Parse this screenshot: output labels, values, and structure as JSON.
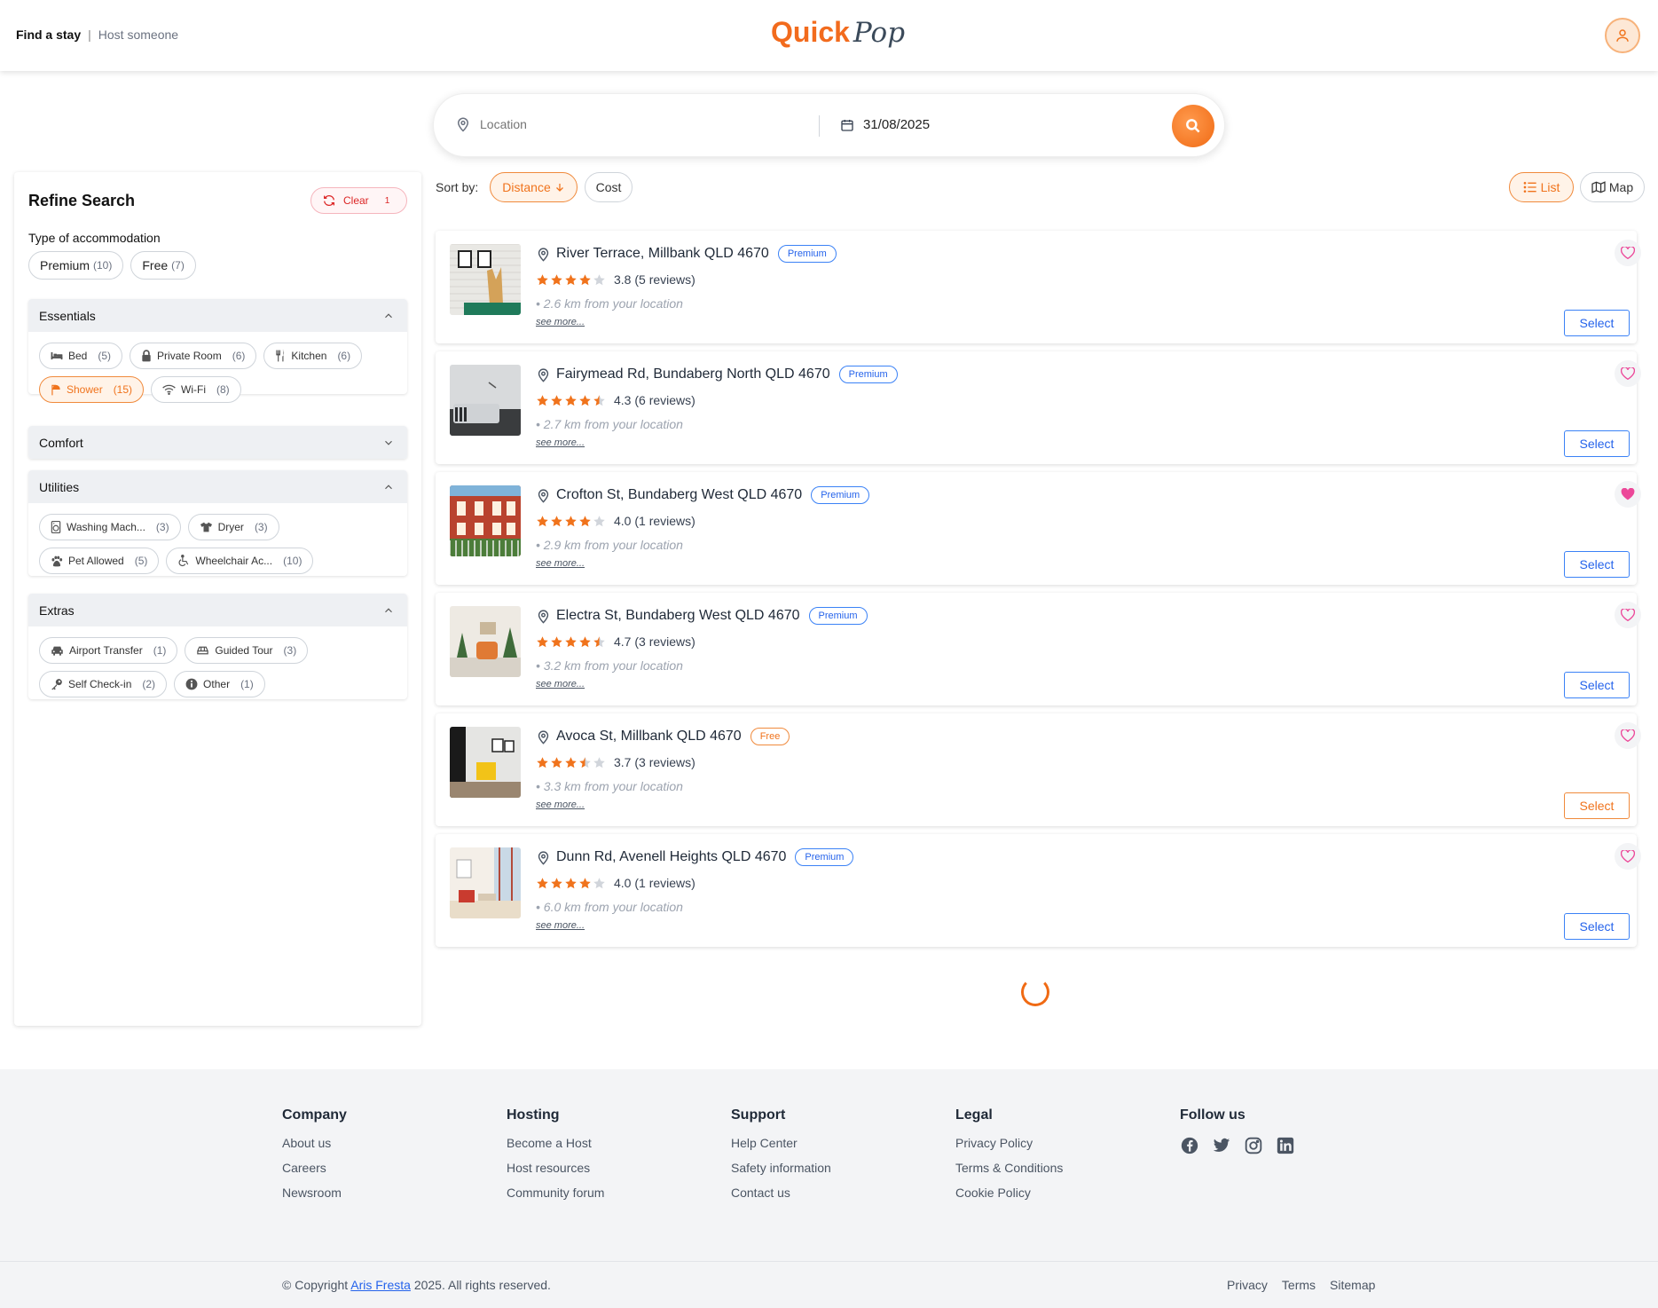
{
  "header": {
    "nav_active": "Find a stay",
    "nav_separator": "|",
    "nav_inactive": "Host someone",
    "logo_quick": "Quick",
    "logo_pop": "Pop"
  },
  "search": {
    "location_placeholder": "Location",
    "date_value": "31/08/2025"
  },
  "sidebar": {
    "title": "Refine Search",
    "clear_label": "Clear",
    "clear_count": "1",
    "type_label": "Type of accommodation",
    "type_chips": [
      {
        "label": "Premium",
        "count": "(10)"
      },
      {
        "label": "Free",
        "count": "(7)"
      }
    ],
    "sections": {
      "essentials": {
        "title": "Essentials",
        "chips": [
          {
            "icon": "bed-icon",
            "label": "Bed",
            "count": "(5)"
          },
          {
            "icon": "lock-icon",
            "label": "Private Room",
            "count": "(6)"
          },
          {
            "icon": "utensils-icon",
            "label": "Kitchen",
            "count": "(6)"
          },
          {
            "icon": "shower-icon",
            "label": "Shower",
            "count": "(15)",
            "selected": true
          },
          {
            "icon": "wifi-icon",
            "label": "Wi-Fi",
            "count": "(8)"
          }
        ]
      },
      "comfort": {
        "title": "Comfort"
      },
      "utilities": {
        "title": "Utilities",
        "chips": [
          {
            "icon": "washing-machine-icon",
            "label": "Washing Mach...",
            "count": "(3)"
          },
          {
            "icon": "shirt-icon",
            "label": "Dryer",
            "count": "(3)"
          },
          {
            "icon": "paw-icon",
            "label": "Pet Allowed",
            "count": "(5)"
          },
          {
            "icon": "wheelchair-icon",
            "label": "Wheelchair Ac...",
            "count": "(10)"
          }
        ]
      },
      "extras": {
        "title": "Extras",
        "chips": [
          {
            "icon": "car-icon",
            "label": "Airport Transfer",
            "count": "(1)"
          },
          {
            "icon": "bus-icon",
            "label": "Guided Tour",
            "count": "(3)"
          },
          {
            "icon": "key-icon",
            "label": "Self Check-in",
            "count": "(2)"
          },
          {
            "icon": "info-icon",
            "label": "Other",
            "count": "(1)"
          }
        ]
      }
    }
  },
  "sort": {
    "label": "Sort by:",
    "distance": "Distance",
    "cost": "Cost",
    "list": "List",
    "map": "Map"
  },
  "listings": [
    {
      "address": "River Terrace, Millbank QLD 4670",
      "badge": "Premium",
      "rating": 3.8,
      "rating_text": "3.8 (5 reviews)",
      "distance": "• 2.6 km from your location",
      "see_more": "see more...",
      "select": "Select",
      "favorite": false
    },
    {
      "address": "Fairymead Rd, Bundaberg North QLD 4670",
      "badge": "Premium",
      "rating": 4.3,
      "rating_text": "4.3 (6 reviews)",
      "distance": "• 2.7 km from your location",
      "see_more": "see more...",
      "select": "Select",
      "favorite": false
    },
    {
      "address": "Crofton St, Bundaberg West QLD 4670",
      "badge": "Premium",
      "rating": 4.0,
      "rating_text": "4.0 (1 reviews)",
      "distance": "• 2.9 km from your location",
      "see_more": "see more...",
      "select": "Select",
      "favorite": true
    },
    {
      "address": "Electra St, Bundaberg West QLD 4670",
      "badge": "Premium",
      "rating": 4.7,
      "rating_text": "4.7 (3 reviews)",
      "distance": "• 3.2 km from your location",
      "see_more": "see more...",
      "select": "Select",
      "favorite": false
    },
    {
      "address": "Avoca St, Millbank QLD 4670",
      "badge": "Free",
      "rating": 3.7,
      "rating_text": "3.7 (3 reviews)",
      "distance": "• 3.3 km from your location",
      "see_more": "see more...",
      "select": "Select",
      "favorite": false
    },
    {
      "address": "Dunn Rd, Avenell Heights QLD 4670",
      "badge": "Premium",
      "rating": 4.0,
      "rating_text": "4.0 (1 reviews)",
      "distance": "• 6.0 km from your location",
      "see_more": "see more...",
      "select": "Select",
      "favorite": false
    }
  ],
  "footer": {
    "company": {
      "title": "Company",
      "links": [
        "About us",
        "Careers",
        "Newsroom"
      ]
    },
    "hosting": {
      "title": "Hosting",
      "links": [
        "Become a Host",
        "Host resources",
        "Community forum"
      ]
    },
    "support": {
      "title": "Support",
      "links": [
        "Help Center",
        "Safety information",
        "Contact us"
      ]
    },
    "legal": {
      "title": "Legal",
      "links": [
        "Privacy Policy",
        "Terms & Conditions",
        "Cookie Policy"
      ]
    },
    "follow": {
      "title": "Follow us",
      "icons": [
        "facebook-icon",
        "twitter-icon",
        "instagram-icon",
        "linkedin-icon"
      ]
    },
    "copyright_prefix": "© Copyright",
    "copyright_name": "Aris Fresta",
    "copyright_suffix": "2025. All rights reserved.",
    "bottom_links": [
      "Privacy",
      "Terms",
      "Sitemap"
    ]
  },
  "colors": {
    "accent": "#f0731c",
    "premium": "#2563eb",
    "heart": "#ec4899"
  }
}
